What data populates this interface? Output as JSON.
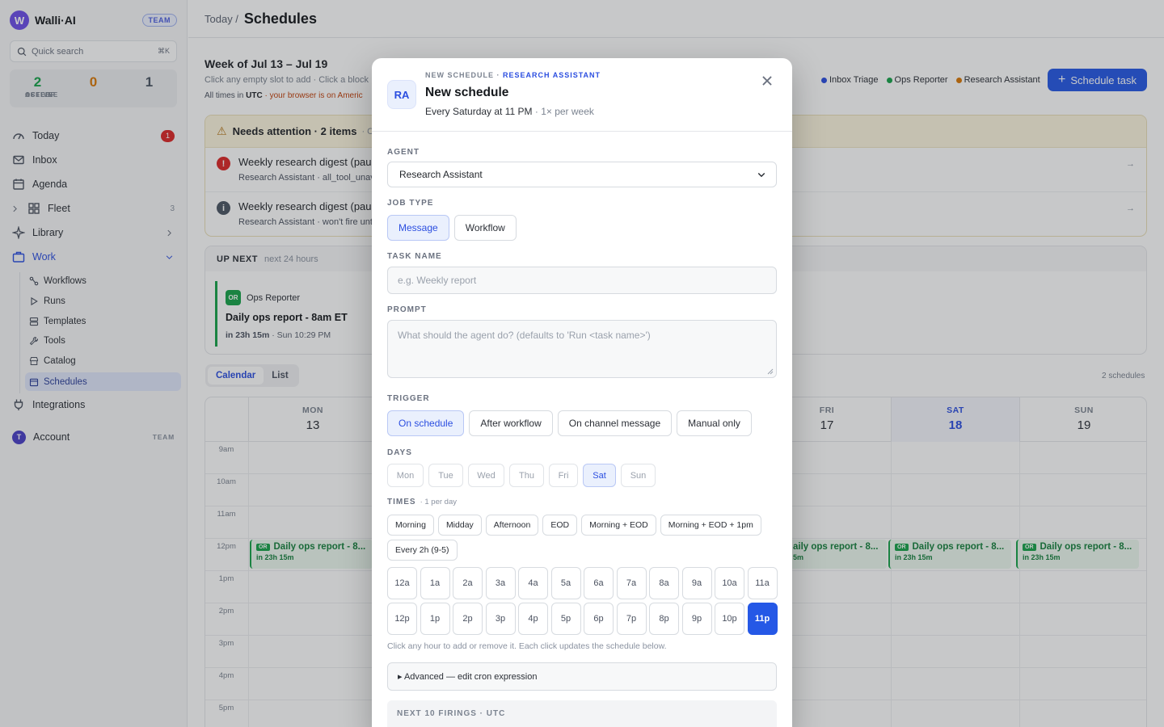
{
  "brand": {
    "logo_letter": "W",
    "name": "Walli·AI",
    "badge": "TEAM"
  },
  "search": {
    "label": "Quick search",
    "shortcut": "⌘K"
  },
  "stats": [
    {
      "value": "2",
      "label": "ACTIVE",
      "color": "#16a34a"
    },
    {
      "value": "0",
      "label": "ASLEEP",
      "color": "#d97706"
    },
    {
      "value": "1",
      "label": "OFFLINE",
      "color": "#4b5563"
    }
  ],
  "nav": {
    "today": {
      "label": "Today",
      "badge": "1"
    },
    "inbox": {
      "label": "Inbox"
    },
    "agenda": {
      "label": "Agenda"
    },
    "fleet": {
      "label": "Fleet",
      "count": "3"
    },
    "library": {
      "label": "Library"
    },
    "work": {
      "label": "Work"
    },
    "work_items": [
      "Workflows",
      "Runs",
      "Templates",
      "Tools",
      "Catalog",
      "Schedules"
    ],
    "integrations": {
      "label": "Integrations"
    },
    "account": {
      "avatar": "T",
      "label": "Account",
      "badge": "TEAM"
    }
  },
  "topbar": {
    "crumb": "Today /",
    "title": "Schedules"
  },
  "week": {
    "title": "Week of Jul 13 – Jul 19",
    "sub": "Click any empty slot to add · Click a block",
    "tz_prefix": "All times in",
    "tz": "UTC",
    "tz_warn": "· your browser is on Americ"
  },
  "legend": [
    {
      "label": "Inbox Triage",
      "color": "#2b4ee0"
    },
    {
      "label": "Ops Reporter",
      "color": "#16a34a"
    },
    {
      "label": "Research Assistant",
      "color": "#d97706"
    }
  ],
  "schedule_button": "Schedule task",
  "attention": {
    "title": "Needs attention · 2 items",
    "suffix": "· Cl",
    "rows": [
      {
        "title": "Weekly research digest (paus",
        "sub": "Research Assistant · all_tool_unav"
      },
      {
        "title": "Weekly research digest (paus",
        "sub": "Research Assistant · won't fire unt"
      }
    ]
  },
  "upnext": {
    "title": "UP NEXT",
    "sub": "next 24 hours",
    "card": {
      "agent_initials": "OR",
      "agent": "Ops Reporter",
      "title": "Daily ops report - 8am ET",
      "eta": "in 23h 15m",
      "when": "· Sun 10:29 PM"
    }
  },
  "view_tabs": [
    "Calendar",
    "List"
  ],
  "schedule_count": "2 schedules",
  "calendar": {
    "days": [
      {
        "name": "MON",
        "date": "13"
      },
      {
        "name": "FRI",
        "date": "17"
      },
      {
        "name": "SAT",
        "date": "18"
      },
      {
        "name": "SUN",
        "date": "19"
      }
    ],
    "hours": [
      "9am",
      "10am",
      "11am",
      "12pm",
      "1pm",
      "2pm",
      "3pm",
      "4pm",
      "5pm"
    ],
    "event_chip": "OR",
    "event_title": "Daily ops report - 8...",
    "event_title_cut": "aily ops report - 8...",
    "event_eta": "in 23h 15m",
    "event_eta_cut": "5m"
  },
  "modal": {
    "avatar": "RA",
    "eyebrow": "NEW SCHEDULE ·",
    "eyebrow_agent": "RESEARCH ASSISTANT",
    "title": "New schedule",
    "summary": "Every Saturday at 11 PM",
    "summary_freq": "· 1× per week",
    "agent_label": "AGENT",
    "agent_value": "Research Assistant",
    "job_type_label": "JOB TYPE",
    "job_types": [
      {
        "label": "Message",
        "active": true
      },
      {
        "label": "Workflow",
        "active": false
      }
    ],
    "task_name_label": "TASK NAME",
    "task_name_placeholder": "e.g. Weekly report",
    "prompt_label": "PROMPT",
    "prompt_placeholder": "What should the agent do? (defaults to 'Run <task name>')",
    "trigger_label": "TRIGGER",
    "triggers": [
      "On schedule",
      "After workflow",
      "On channel message",
      "Manual only"
    ],
    "trigger_active": "On schedule",
    "days_label": "DAYS",
    "days": [
      "Mon",
      "Tue",
      "Wed",
      "Thu",
      "Fri",
      "Sat",
      "Sun"
    ],
    "days_active": [
      "Sat"
    ],
    "times_label": "TIMES",
    "times_sub": "· 1 per day",
    "time_presets": [
      "Morning",
      "Midday",
      "Afternoon",
      "EOD",
      "Morning + EOD",
      "Morning + EOD + 1pm",
      "Every 2h (9-5)"
    ],
    "hours": [
      "12a",
      "1a",
      "2a",
      "3a",
      "4a",
      "5a",
      "6a",
      "7a",
      "8a",
      "9a",
      "10a",
      "11a",
      "12p",
      "1p",
      "2p",
      "3p",
      "4p",
      "5p",
      "6p",
      "7p",
      "8p",
      "9p",
      "10p",
      "11p"
    ],
    "hours_active": [
      "11p"
    ],
    "hint": "Click any hour to add or remove it. Each click updates the schedule below.",
    "advanced": "▸ Advanced — edit cron expression",
    "firings_label": "NEXT 10 FIRINGS · UTC"
  }
}
